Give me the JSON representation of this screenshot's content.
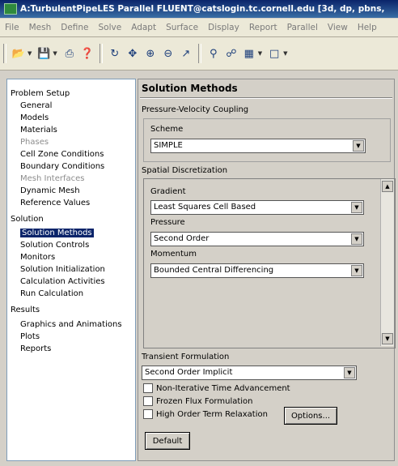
{
  "window": {
    "title": "A:TurbulentPipeLES Parallel FLUENT@catslogin.tc.cornell.edu [3d, dp, pbns,"
  },
  "menu": [
    "File",
    "Mesh",
    "Define",
    "Solve",
    "Adapt",
    "Surface",
    "Display",
    "Report",
    "Parallel",
    "View",
    "Help"
  ],
  "toolbar_icons": [
    "open-icon",
    "save-icon",
    "print-icon",
    "help-icon",
    "rotate-icon",
    "pan-icon",
    "zoom-in-icon",
    "zoom-out-icon",
    "probe-icon",
    "zoom-fit-icon",
    "fit-icon",
    "layout-icon",
    "window-icon"
  ],
  "tree": {
    "problem_setup": "Problem Setup",
    "items_setup": [
      "General",
      "Models",
      "Materials",
      "Phases",
      "Cell Zone Conditions",
      "Boundary Conditions",
      "Mesh Interfaces",
      "Dynamic Mesh",
      "Reference Values"
    ],
    "solution": "Solution",
    "items_solution": [
      "Solution Methods",
      "Solution Controls",
      "Monitors",
      "Solution Initialization",
      "Calculation Activities",
      "Run Calculation"
    ],
    "results": "Results",
    "items_results": [
      "Graphics and Animations",
      "Plots",
      "Reports"
    ]
  },
  "panel": {
    "heading": "Solution Methods",
    "pv_coupling": "Pressure-Velocity Coupling",
    "scheme_label": "Scheme",
    "scheme_value": "SIMPLE",
    "spatial": "Spatial Discretization",
    "gradient_label": "Gradient",
    "gradient_value": "Least Squares Cell Based",
    "pressure_label": "Pressure",
    "pressure_value": "Second Order",
    "momentum_label": "Momentum",
    "momentum_value": "Bounded Central Differencing",
    "transient_label": "Transient Formulation",
    "transient_value": "Second Order Implicit",
    "non_iterative": "Non-Iterative Time Advancement",
    "frozen_flux": "Frozen Flux Formulation",
    "high_order": "High Order Term Relaxation",
    "options_button": "Options...",
    "default_button": "Default"
  }
}
